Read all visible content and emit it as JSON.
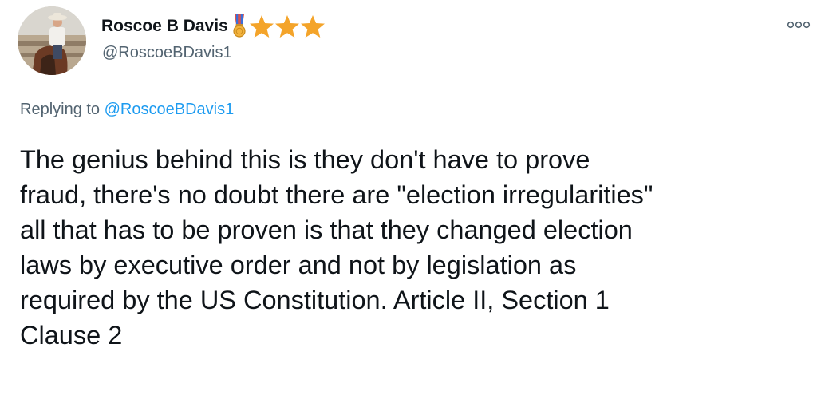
{
  "tweet": {
    "author": {
      "display_name": "Roscoe B Davis",
      "handle": "@RoscoeBDavis1",
      "badge_icon": "military-medal-icon",
      "badge_stars_icon": "star-icon",
      "badge_star_count": 3,
      "star_color": "#f4a42a"
    },
    "more_icon": "more-options-icon",
    "replying": {
      "prefix": "Replying to",
      "mention": "@RoscoeBDavis1",
      "mention_color": "#1d9bf0"
    },
    "body_lines": [
      "The genius behind this is they don't have to prove",
      "fraud, there's no doubt there are \"election irregularities\"",
      "all that has to be proven is that they changed election",
      "laws by executive order and not by legislation as",
      "required by the US Constitution. Article II, Section 1",
      "Clause 2"
    ]
  }
}
